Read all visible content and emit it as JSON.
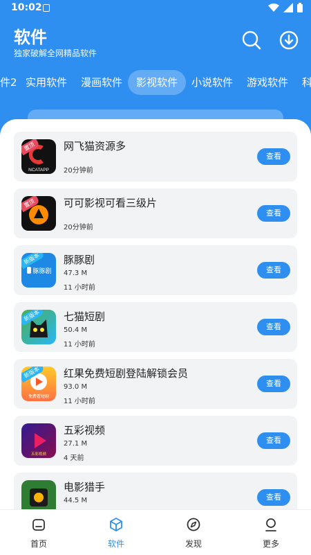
{
  "status": {
    "time": "10:02"
  },
  "header": {
    "title": "软件",
    "subtitle": "独家破解全网精品软件"
  },
  "tabs": [
    {
      "label": "件2",
      "active": false
    },
    {
      "label": "实用软件",
      "active": false
    },
    {
      "label": "漫画软件",
      "active": false
    },
    {
      "label": "影视软件",
      "active": true
    },
    {
      "label": "小说软件",
      "active": false
    },
    {
      "label": "游戏软件",
      "active": false
    },
    {
      "label": "科",
      "active": false
    }
  ],
  "apps": [
    {
      "name": "网飞猫资源多",
      "size": "",
      "time": "20分钟前",
      "badge": "置顶",
      "badge_color": "#e84a5f",
      "icon_text": "NCATAPP",
      "icon_color": "#111111",
      "accent": "#e53935",
      "button": "查看"
    },
    {
      "name": "可可影视可看三级片",
      "size": "",
      "time": "20分钟前",
      "badge": "置顶",
      "badge_color": "#e84a5f",
      "icon_text": "",
      "icon_color": "#111111",
      "accent": "#ff8c00",
      "button": "查看"
    },
    {
      "name": "豚豚剧",
      "size": "47.3 M",
      "time": "11 小时前",
      "badge": "新版本",
      "badge_color": "#29b6f6",
      "icon_text": "豚豚剧",
      "icon_color": "#1e88e5",
      "accent": "#64b5f6",
      "button": "查看"
    },
    {
      "name": "七猫短剧",
      "size": "50.4 M",
      "time": "11 小时前",
      "badge": "新版本",
      "badge_color": "#29b6f6",
      "icon_text": "",
      "icon_color": "#2a2a2a",
      "accent": "#4caf50",
      "button": "查看"
    },
    {
      "name": "红果免费短剧登陆解锁会员",
      "size": "93.0 M",
      "time": "11 小时前",
      "badge": "新版本",
      "badge_color": "#29b6f6",
      "icon_text": "免费看短剧",
      "icon_color": "#ff7043",
      "accent": "#ffca28",
      "button": "查看"
    },
    {
      "name": "五彩视频",
      "size": "27.1 M",
      "time": "4 天前",
      "badge": "",
      "badge_color": "",
      "icon_text": "五彩视频",
      "icon_color": "#7b1fa2",
      "accent": "#e91e63",
      "button": "查看"
    },
    {
      "name": "电影猎手",
      "size": "44.5 M",
      "time": "",
      "badge": "",
      "badge_color": "",
      "icon_text": "",
      "icon_color": "#2e7d32",
      "accent": "#ffb300",
      "button": "查看"
    }
  ],
  "nav": [
    {
      "label": "首页",
      "icon": "home-icon",
      "active": false
    },
    {
      "label": "软件",
      "icon": "cube-icon",
      "active": true
    },
    {
      "label": "发现",
      "icon": "compass-icon",
      "active": false
    },
    {
      "label": "更多",
      "icon": "user-icon",
      "active": false
    }
  ]
}
